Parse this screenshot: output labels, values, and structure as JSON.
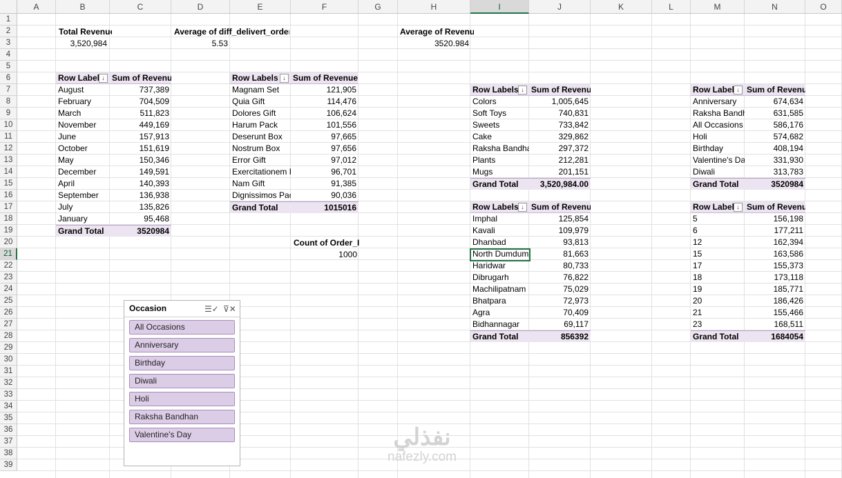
{
  "columns": [
    "A",
    "B",
    "C",
    "D",
    "E",
    "F",
    "G",
    "H",
    "I",
    "J",
    "K",
    "L",
    "M",
    "N",
    "O"
  ],
  "selected_column": "I",
  "selected_row": "21",
  "rows": [
    "1",
    "2",
    "3",
    "4",
    "5",
    "6",
    "7",
    "8",
    "9",
    "10",
    "11",
    "12",
    "13",
    "14",
    "15",
    "16",
    "17",
    "18",
    "19",
    "20",
    "21",
    "22",
    "23",
    "24",
    "25",
    "26",
    "27",
    "28",
    "29",
    "30",
    "31",
    "32",
    "33",
    "34",
    "35",
    "36",
    "37",
    "38",
    "39"
  ],
  "kpis": {
    "total_revenue": {
      "label": "Total Revenue",
      "value": "3,520,984"
    },
    "avg_diff": {
      "label": "Average of diff_delivert_order",
      "value": "5.53"
    },
    "avg_revenue": {
      "label": "Average of Revenue",
      "value": "3520.984"
    },
    "count_order": {
      "label": "Count of Order_ID",
      "value": "1000"
    }
  },
  "pivot_month": {
    "header": {
      "label": "Row Labels",
      "value": "Sum of Revenue"
    },
    "rows": [
      {
        "label": "August",
        "value": "737,389"
      },
      {
        "label": "February",
        "value": "704,509"
      },
      {
        "label": "March",
        "value": "511,823"
      },
      {
        "label": "November",
        "value": "449,169"
      },
      {
        "label": "June",
        "value": "157,913"
      },
      {
        "label": "October",
        "value": "151,619"
      },
      {
        "label": "May",
        "value": "150,346"
      },
      {
        "label": "December",
        "value": "149,591"
      },
      {
        "label": "April",
        "value": "140,393"
      },
      {
        "label": "September",
        "value": "136,938"
      },
      {
        "label": "July",
        "value": "135,826"
      },
      {
        "label": "January",
        "value": "95,468"
      }
    ],
    "total": {
      "label": "Grand Total",
      "value": "3520984"
    }
  },
  "pivot_product": {
    "header": {
      "label": "Row Labels",
      "value": "Sum of Revenue"
    },
    "rows": [
      {
        "label": "Magnam Set",
        "value": "121,905"
      },
      {
        "label": "Quia Gift",
        "value": "114,476"
      },
      {
        "label": "Dolores Gift",
        "value": "106,624"
      },
      {
        "label": "Harum Pack",
        "value": "101,556"
      },
      {
        "label": "Deserunt Box",
        "value": "97,665"
      },
      {
        "label": "Nostrum Box",
        "value": "97,656"
      },
      {
        "label": "Error Gift",
        "value": "97,012"
      },
      {
        "label": "Exercitationem P",
        "value": "96,701"
      },
      {
        "label": "Nam Gift",
        "value": "91,385"
      },
      {
        "label": "Dignissimos Pac",
        "value": "90,036"
      }
    ],
    "total": {
      "label": "Grand Total",
      "value": "1015016"
    }
  },
  "pivot_category": {
    "header": {
      "label": "Row Labels",
      "value": "Sum of Revenue"
    },
    "rows": [
      {
        "label": "Colors",
        "value": "1,005,645"
      },
      {
        "label": "Soft Toys",
        "value": "740,831"
      },
      {
        "label": "Sweets",
        "value": "733,842"
      },
      {
        "label": "Cake",
        "value": "329,862"
      },
      {
        "label": "Raksha Bandha",
        "value": "297,372"
      },
      {
        "label": "Plants",
        "value": "212,281"
      },
      {
        "label": "Mugs",
        "value": "201,151"
      }
    ],
    "total": {
      "label": "Grand Total",
      "value": "3,520,984.00"
    }
  },
  "pivot_city": {
    "header": {
      "label": "Row Labels",
      "value": "Sum of Revenue"
    },
    "rows": [
      {
        "label": "Imphal",
        "value": "125,854"
      },
      {
        "label": "Kavali",
        "value": "109,979"
      },
      {
        "label": "Dhanbad",
        "value": "93,813"
      },
      {
        "label": "North Dumdum",
        "value": "81,663"
      },
      {
        "label": "Haridwar",
        "value": "80,733"
      },
      {
        "label": "Dibrugarh",
        "value": "76,822"
      },
      {
        "label": "Machilipatnam",
        "value": "75,029"
      },
      {
        "label": "Bhatpara",
        "value": "72,973"
      },
      {
        "label": "Agra",
        "value": "70,409"
      },
      {
        "label": "Bidhannagar",
        "value": "69,117"
      }
    ],
    "total": {
      "label": "Grand Total",
      "value": "856392"
    }
  },
  "pivot_occasion": {
    "header": {
      "label": "Row Labels",
      "value": "Sum of Revenue"
    },
    "rows": [
      {
        "label": "Anniversary",
        "value": "674,634"
      },
      {
        "label": "Raksha Bandh",
        "value": "631,585"
      },
      {
        "label": "All Occasions",
        "value": "586,176"
      },
      {
        "label": "Holi",
        "value": "574,682"
      },
      {
        "label": "Birthday",
        "value": "408,194"
      },
      {
        "label": "Valentine's Da",
        "value": "331,930"
      },
      {
        "label": "Diwali",
        "value": "313,783"
      }
    ],
    "total": {
      "label": "Grand Total",
      "value": "3520984"
    }
  },
  "pivot_hour": {
    "header": {
      "label": "Row Labels",
      "value": "Sum of Revenue"
    },
    "rows": [
      {
        "label": "5",
        "value": "156,198"
      },
      {
        "label": "6",
        "value": "177,211"
      },
      {
        "label": "12",
        "value": "162,394"
      },
      {
        "label": "15",
        "value": "163,586"
      },
      {
        "label": "17",
        "value": "155,373"
      },
      {
        "label": "18",
        "value": "173,118"
      },
      {
        "label": "19",
        "value": "185,771"
      },
      {
        "label": "20",
        "value": "186,426"
      },
      {
        "label": "21",
        "value": "155,466"
      },
      {
        "label": "23",
        "value": "168,511"
      }
    ],
    "total": {
      "label": "Grand Total",
      "value": "1684054"
    }
  },
  "slicer": {
    "title": "Occasion",
    "items": [
      "All Occasions",
      "Anniversary",
      "Birthday",
      "Diwali",
      "Holi",
      "Raksha Bandhan",
      "Valentine's Day"
    ],
    "multiselect_icon": "multi-select-icon",
    "clear_icon": "clear-filter-icon"
  },
  "watermark": {
    "arabic": "نفذلي",
    "latin": "nafezly.com"
  },
  "colors": {
    "accent": "#217346",
    "pivot_header": "#ece4f0",
    "slicer_item": "#dccde7"
  }
}
